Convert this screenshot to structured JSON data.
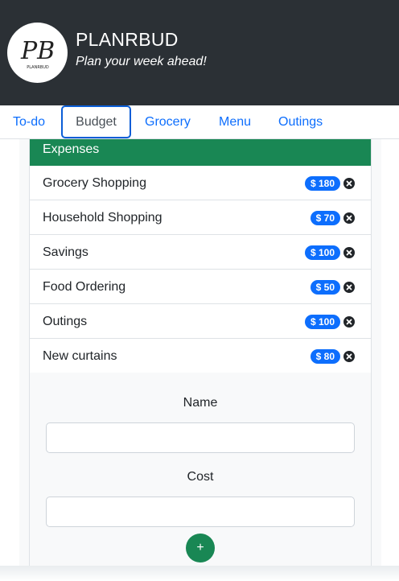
{
  "header": {
    "title": "PLANRBUD",
    "tagline": "Plan your week ahead!",
    "logo_monogram": "PB",
    "logo_caption": "PLANRBUD"
  },
  "nav": {
    "tabs": [
      {
        "label": "To-do",
        "active": false
      },
      {
        "label": "Budget",
        "active": true
      },
      {
        "label": "Grocery",
        "active": false
      },
      {
        "label": "Menu",
        "active": false
      },
      {
        "label": "Outings",
        "active": false
      }
    ]
  },
  "expenses": {
    "header": "Expenses",
    "items": [
      {
        "name": "Grocery Shopping",
        "amount": "$ 180"
      },
      {
        "name": "Household Shopping",
        "amount": "$ 70"
      },
      {
        "name": "Savings",
        "amount": "$ 100"
      },
      {
        "name": "Food Ordering",
        "amount": "$ 50"
      },
      {
        "name": "Outings",
        "amount": "$ 100"
      },
      {
        "name": "New curtains",
        "amount": "$ 80"
      }
    ]
  },
  "form": {
    "name_label": "Name",
    "name_value": "",
    "cost_label": "Cost",
    "cost_value": "",
    "add_label": "+"
  },
  "colors": {
    "topbar": "#2b3035",
    "accent_green": "#198754",
    "badge_blue": "#0d6efd",
    "link_blue": "#0d6efd"
  }
}
